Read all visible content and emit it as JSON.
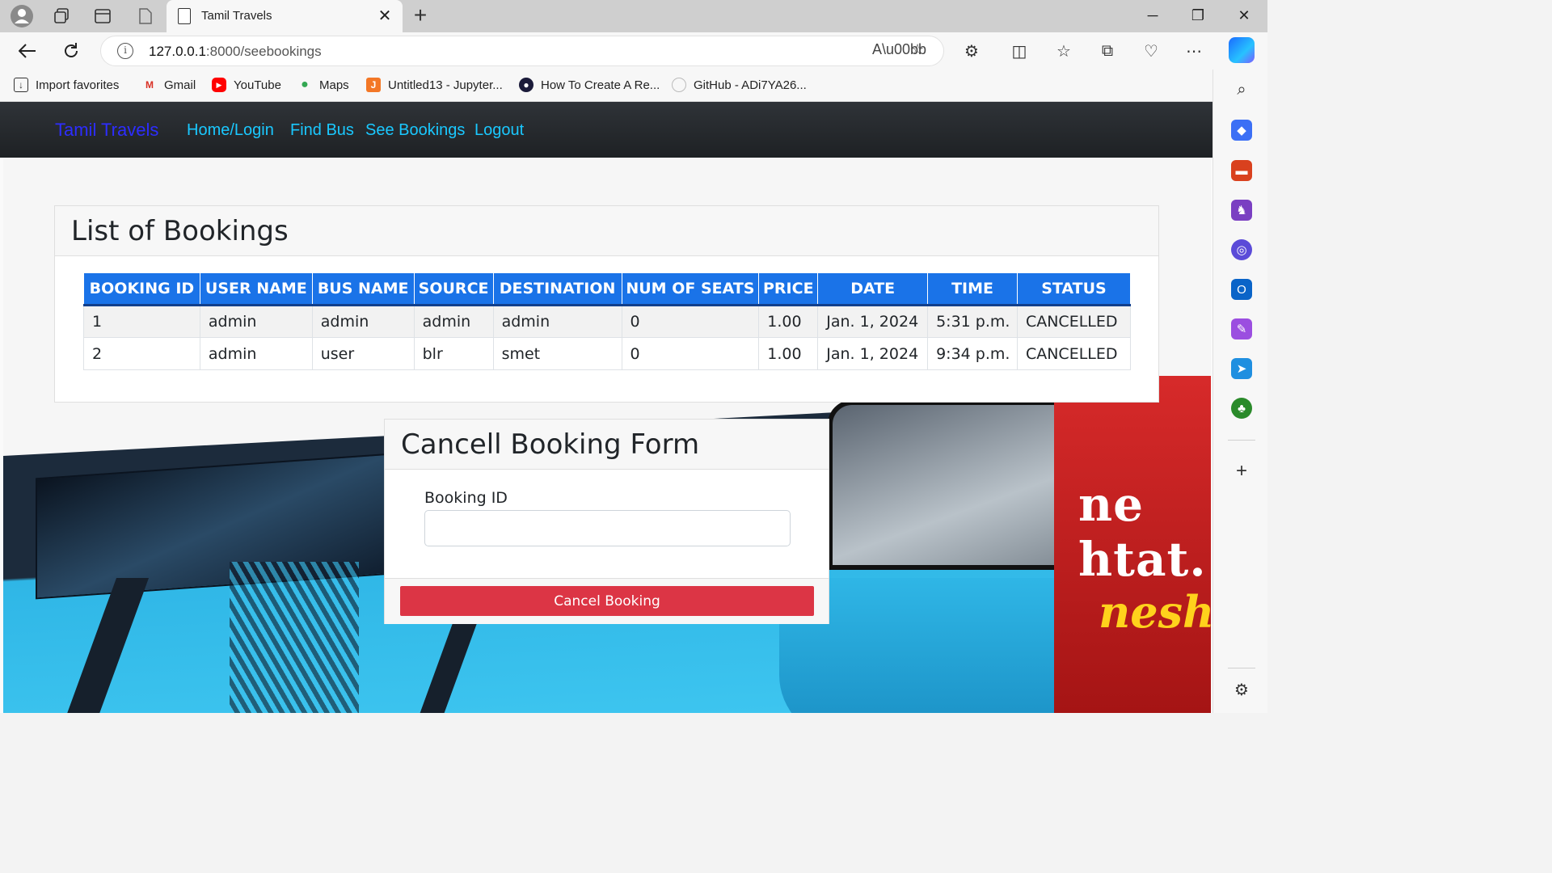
{
  "browser": {
    "tab_title": "Tamil Travels",
    "url_host": "127.0.0.1",
    "url_path": ":8000/seebookings",
    "bookmarks": [
      {
        "label": "Import favorites"
      },
      {
        "label": "Gmail"
      },
      {
        "label": "YouTube"
      },
      {
        "label": "Maps"
      },
      {
        "label": "Untitled13 - Jupyter..."
      },
      {
        "label": "How To Create A Re..."
      },
      {
        "label": "GitHub - ADi7YA26..."
      }
    ]
  },
  "navbar": {
    "brand": "Tamil Travels",
    "links": [
      "Home/Login",
      "Find Bus",
      "See Bookings",
      "Logout"
    ]
  },
  "bookings": {
    "title": "List of Bookings",
    "columns": [
      "BOOKING ID",
      "USER NAME",
      "BUS NAME",
      "SOURCE",
      "DESTINATION",
      "NUM OF SEATS",
      "PRICE",
      "DATE",
      "TIME",
      "STATUS"
    ],
    "rows": [
      [
        "1",
        "admin",
        "admin",
        "admin",
        "admin",
        "0",
        "1.00",
        "Jan. 1, 2024",
        "5:31 p.m.",
        "CANCELLED"
      ],
      [
        "2",
        "admin",
        "user",
        "blr",
        "smet",
        "0",
        "1.00",
        "Jan. 1, 2024",
        "9:34 p.m.",
        "CANCELLED"
      ]
    ]
  },
  "cancel_form": {
    "title": "Cancell Booking Form",
    "field_label": "Booking ID",
    "field_value": "",
    "button_label": "Cancel Booking"
  },
  "background_text": {
    "red_bus_1": "ne  htat.",
    "red_bus_2": "nesh"
  },
  "colors": {
    "brand": "#2d2dff",
    "nav_link": "#1ac8ff",
    "table_header": "#1a73e8",
    "danger_button": "#dc3545"
  }
}
